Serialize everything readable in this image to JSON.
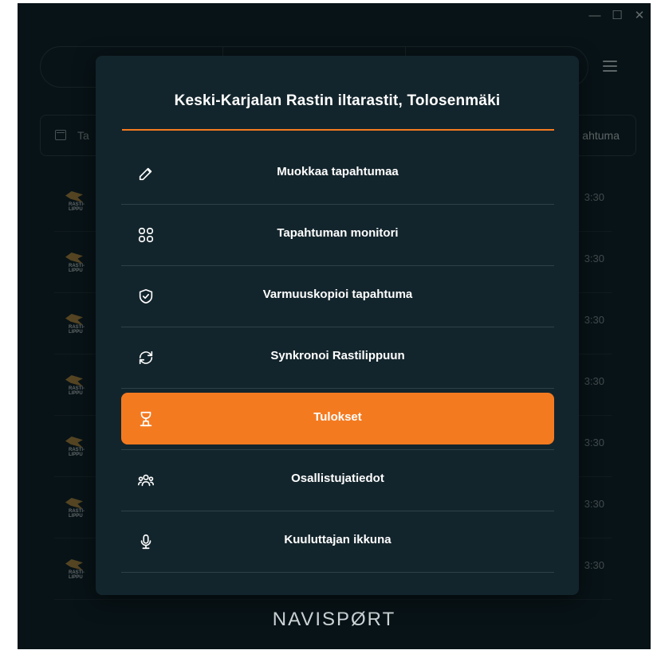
{
  "window": {
    "controls": [
      "—",
      "☐",
      "✕"
    ]
  },
  "background": {
    "filter_left": "Ta",
    "filter_right": "ahtuma",
    "rows": [
      {
        "logo": "RASTI-\nLIPPU",
        "time": "3:30"
      },
      {
        "logo": "RASTI-\nLIPPU",
        "time": "3:30"
      },
      {
        "logo": "RASTI-\nLIPPU",
        "time": "3:30"
      },
      {
        "logo": "RASTI-\nLIPPU",
        "time": "3:30"
      },
      {
        "logo": "RASTI-\nLIPPU",
        "time": "3:30"
      },
      {
        "logo": "RASTI-\nLIPPU",
        "time": "3:30"
      },
      {
        "logo": "RASTI-\nLIPPU",
        "time": "3:30"
      }
    ],
    "brand": "NAVISPØRT"
  },
  "modal": {
    "title": "Keski-Karjalan Rastin iltarastit, Tolosenmäki",
    "accent": "#f47a20",
    "items": [
      {
        "label": "Muokkaa tapahtumaa",
        "icon": "edit-icon",
        "active": false
      },
      {
        "label": "Tapahtuman monitori",
        "icon": "grid-icon",
        "active": false
      },
      {
        "label": "Varmuuskopioi tapahtuma",
        "icon": "shield-check-icon",
        "active": false
      },
      {
        "label": "Synkronoi Rastilippuun",
        "icon": "sync-icon",
        "active": false
      },
      {
        "label": "Tulokset",
        "icon": "trophy-icon",
        "active": true
      },
      {
        "label": "Osallistujatiedot",
        "icon": "users-icon",
        "active": false
      },
      {
        "label": "Kuuluttajan ikkuna",
        "icon": "microphone-icon",
        "active": false
      }
    ]
  }
}
